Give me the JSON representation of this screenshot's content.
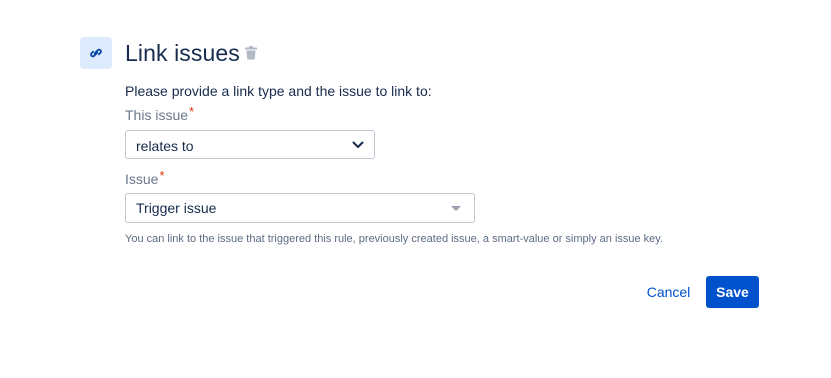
{
  "header": {
    "icon": "link-icon",
    "title": "Link issues",
    "delete_icon": "trash-icon"
  },
  "form": {
    "prompt": "Please provide a link type and the issue to link to:",
    "this_issue": {
      "label": "This issue",
      "required_mark": "*",
      "value": "relates to"
    },
    "issue": {
      "label": "Issue",
      "required_mark": "*",
      "value": "Trigger issue",
      "help": "You can link to the issue that triggered this rule, previously created issue, a smart-value or simply an issue key."
    }
  },
  "actions": {
    "cancel_label": "Cancel",
    "save_label": "Save"
  },
  "colors": {
    "primary": "#0052cc",
    "icon_bg": "#deebff",
    "required": "#de350b",
    "text": "#172b4d"
  }
}
